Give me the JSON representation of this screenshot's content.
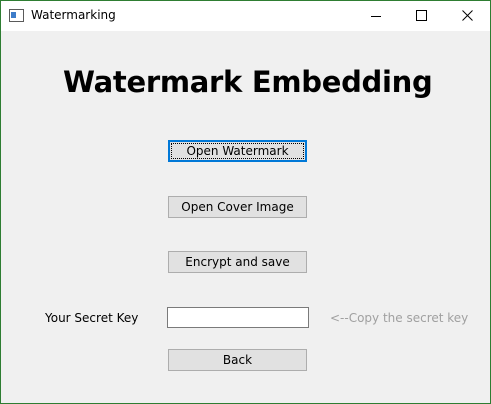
{
  "window": {
    "title": "Watermarking",
    "icon": "app-window-icon",
    "controls": {
      "minimize": "minimize-icon",
      "maximize": "maximize-icon",
      "close": "close-icon"
    },
    "border_color": "#2e7d32"
  },
  "main": {
    "heading": "Watermark Embedding",
    "buttons": {
      "open_watermark": "Open Watermark",
      "open_cover": "Open Cover Image",
      "encrypt_save": "Encrypt and save",
      "back": "Back"
    },
    "secret_key": {
      "label": "Your Secret Key",
      "value": "",
      "hint": "<--Copy the secret key"
    }
  },
  "colors": {
    "background": "#f0f0f0",
    "button": "#e1e1e1",
    "focus_border": "#0078d7",
    "hint_text": "#a0a0a0"
  }
}
